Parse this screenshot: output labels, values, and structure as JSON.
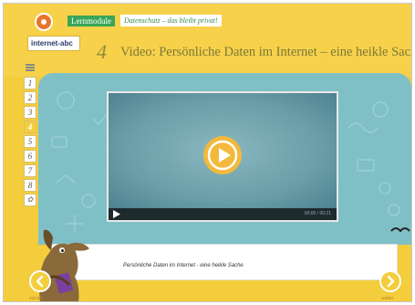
{
  "brand": {
    "logo_text": "internet-abc",
    "module_badge": "Lernmodule",
    "module_subtitle": "Datenschutz – das bleibt privat!"
  },
  "chapter": {
    "number": "4",
    "title": "Video: Persönliche Daten im Internet – eine heikle Sache"
  },
  "nav": {
    "items": [
      {
        "label": "1",
        "active": false
      },
      {
        "label": "2",
        "active": false
      },
      {
        "label": "3",
        "active": false
      },
      {
        "label": "4",
        "active": true
      },
      {
        "label": "5",
        "active": false
      },
      {
        "label": "6",
        "active": false
      },
      {
        "label": "7",
        "active": false
      },
      {
        "label": "8",
        "active": false
      }
    ],
    "extra_icon": "help-icon"
  },
  "video": {
    "time": "00:00 / 00:21"
  },
  "caption": {
    "text": "Persönliche Daten im Internet - eine heikle Sache"
  },
  "footer": {
    "back_label": "zurück",
    "next_label": "weiter"
  },
  "colors": {
    "accent_yellow": "#f3cd3c",
    "stage_teal": "#7fc0c7",
    "play_orange": "#f3b93c",
    "badge_green": "#3aa657"
  }
}
